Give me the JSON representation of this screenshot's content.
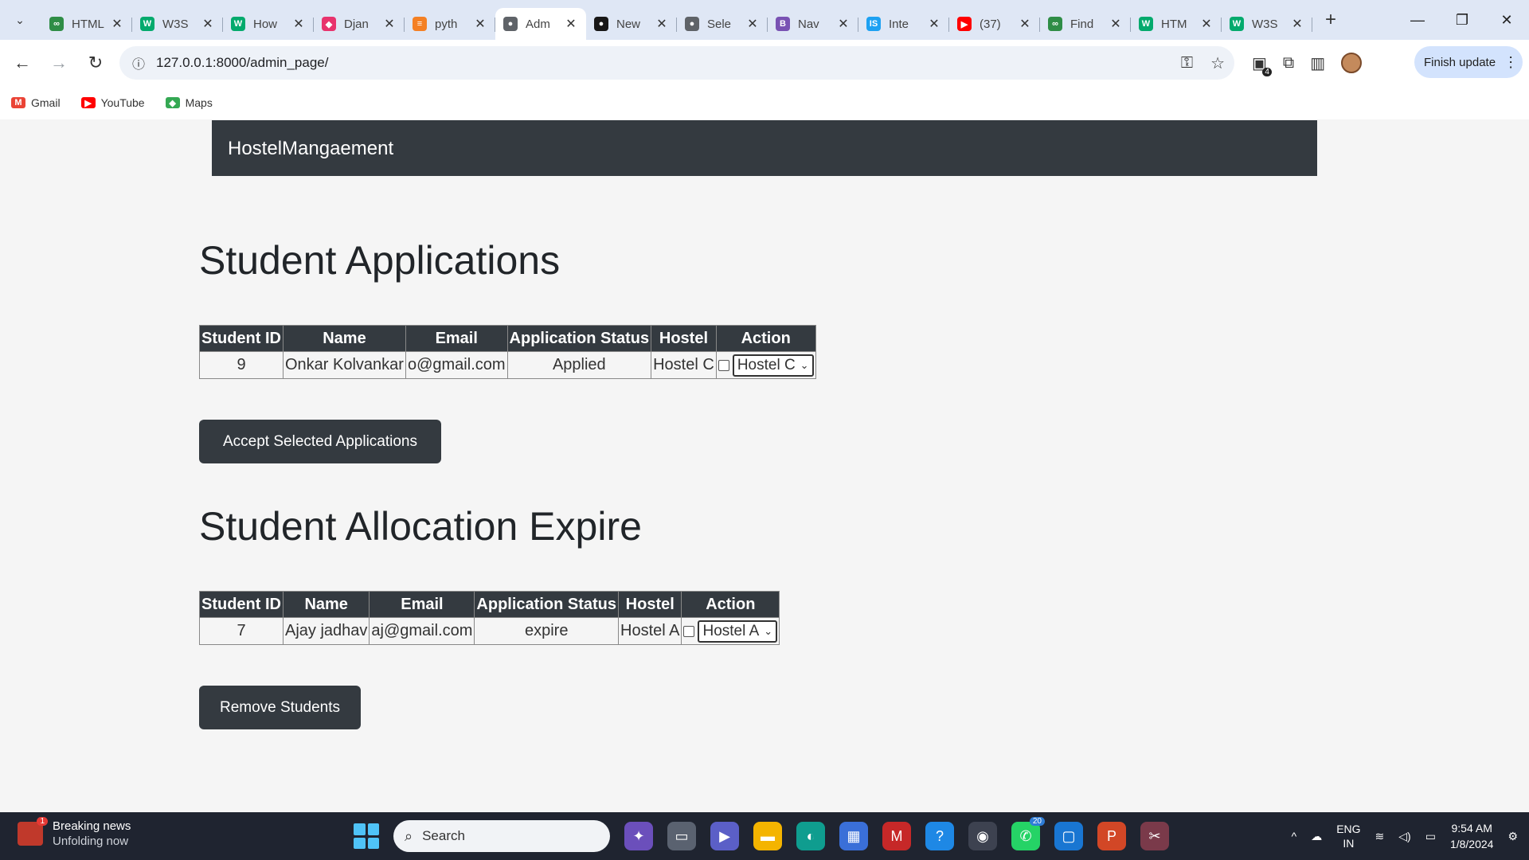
{
  "browser": {
    "tabs": [
      {
        "title": "HTML",
        "favicon": "geeks-icon",
        "color": "#2f8d46",
        "glyph": "∞",
        "active": false
      },
      {
        "title": "W3S",
        "favicon": "w3-icon",
        "color": "#04aa6d",
        "glyph": "W",
        "active": false
      },
      {
        "title": "How",
        "favicon": "w3-icon",
        "color": "#04aa6d",
        "glyph": "W",
        "active": false
      },
      {
        "title": "Djan",
        "favicon": "django-icon",
        "color": "#e8336d",
        "glyph": "◆",
        "active": false
      },
      {
        "title": "pyth",
        "favicon": "stackoverflow-icon",
        "color": "#f48024",
        "glyph": "≡",
        "active": false
      },
      {
        "title": "Adm",
        "favicon": "globe-icon",
        "color": "#5f6368",
        "glyph": "●",
        "active": true
      },
      {
        "title": "New",
        "favicon": "github-icon",
        "color": "#181717",
        "glyph": "●",
        "active": false
      },
      {
        "title": "Sele",
        "favicon": "globe-icon",
        "color": "#5f6368",
        "glyph": "●",
        "active": false
      },
      {
        "title": "Nav",
        "favicon": "bootstrap-icon",
        "color": "#7952b3",
        "glyph": "B",
        "active": false
      },
      {
        "title": "Inte",
        "favicon": "is-icon",
        "color": "#1da1f2",
        "glyph": "IS",
        "active": false
      },
      {
        "title": "(37)",
        "favicon": "youtube-icon",
        "color": "#ff0000",
        "glyph": "▶",
        "active": false
      },
      {
        "title": "Find",
        "favicon": "geeks-icon",
        "color": "#2f8d46",
        "glyph": "∞",
        "active": false
      },
      {
        "title": "HTM",
        "favicon": "w3-icon",
        "color": "#04aa6d",
        "glyph": "W",
        "active": false
      },
      {
        "title": "W3S",
        "favicon": "w3-icon",
        "color": "#04aa6d",
        "glyph": "W",
        "active": false
      }
    ],
    "url": "127.0.0.1:8000/admin_page/",
    "extensions_badge": "4",
    "finish_update_label": "Finish update",
    "bookmarks": [
      {
        "label": "Gmail",
        "icon": "gmail-icon",
        "color": "#ea4335",
        "glyph": "M"
      },
      {
        "label": "YouTube",
        "icon": "youtube-icon",
        "color": "#ff0000",
        "glyph": "▶"
      },
      {
        "label": "Maps",
        "icon": "maps-icon",
        "color": "#34a853",
        "glyph": "◆"
      }
    ]
  },
  "app": {
    "brand": "HostelMangaement",
    "applications": {
      "title": "Student Applications",
      "headers": [
        "Student ID",
        "Name",
        "Email",
        "Application Status",
        "Hostel",
        "Action"
      ],
      "rows": [
        {
          "student_id": "9",
          "name": "Onkar Kolvankar",
          "email": "o@gmail.com",
          "status": "Applied",
          "hostel": "Hostel C",
          "selected_hostel": "Hostel C"
        }
      ],
      "button_label": "Accept Selected Applications"
    },
    "expire": {
      "title": "Student Allocation Expire",
      "headers": [
        "Student ID",
        "Name",
        "Email",
        "Application Status",
        "Hostel",
        "Action"
      ],
      "rows": [
        {
          "student_id": "7",
          "name": "Ajay jadhav",
          "email": "aj@gmail.com",
          "status": "expire",
          "hostel": "Hostel A",
          "selected_hostel": "Hostel A"
        }
      ],
      "button_label": "Remove Students"
    }
  },
  "taskbar": {
    "news_title": "Breaking news",
    "news_subtitle": "Unfolding now",
    "news_badge": "1",
    "search_placeholder": "Search",
    "whatsapp_badge": "20",
    "lang_line1": "ENG",
    "lang_line2": "IN",
    "time": "9:54 AM",
    "date": "1/8/2024"
  },
  "colors": {
    "navbar": "#343a40",
    "page_bg": "#f5f5f5",
    "accent_update": "#d3e3fd"
  }
}
